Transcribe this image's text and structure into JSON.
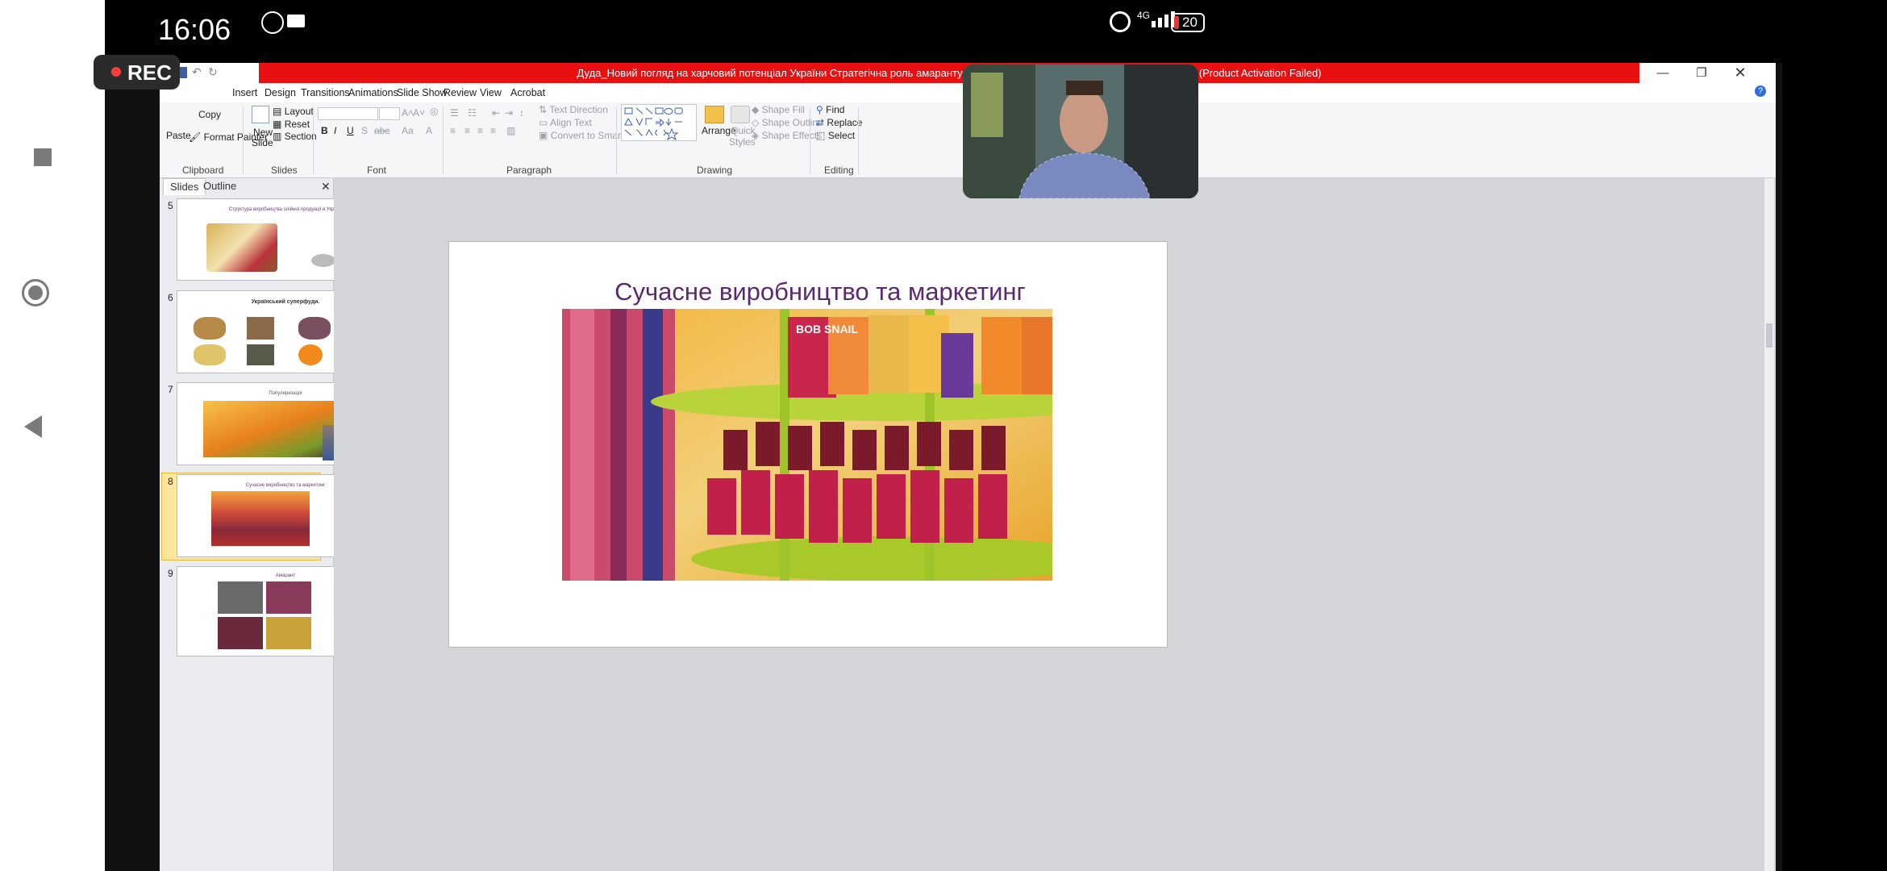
{
  "status_bar": {
    "time": "16:06",
    "network": "4G",
    "battery": "20"
  },
  "rec": {
    "label": "REC"
  },
  "window": {
    "title": "Дуда_Новий погляд на харчовий потенціал України Стратегічна роль амаранту та інших нішевих культур  -  Microsoft PowerPoint (Product Activation Failed)"
  },
  "ribbon_tabs": [
    "Insert",
    "Design",
    "Transitions",
    "Animations",
    "Slide Show",
    "Review",
    "View",
    "Acrobat"
  ],
  "ribbon": {
    "clipboard": {
      "paste": "Paste",
      "copy": "Copy",
      "format_painter": "Format Painter",
      "label": "Clipboard"
    },
    "slides": {
      "new_slide": "New",
      "new_slide2": "Slide",
      "layout": "Layout",
      "reset": "Reset",
      "section": "Section",
      "label": "Slides"
    },
    "font": {
      "label": "Font"
    },
    "paragraph": {
      "text_direction": "Text Direction",
      "align_text": "Align Text",
      "smartart": "Convert to SmartArt",
      "label": "Paragraph"
    },
    "drawing": {
      "arrange": "Arrange",
      "quick_styles": "Quick",
      "quick_styles2": "Styles",
      "shape_fill": "Shape Fill",
      "shape_outline": "Shape Outline",
      "shape_effects": "Shape Effects",
      "label": "Drawing"
    },
    "editing": {
      "find": "Find",
      "replace": "Replace",
      "select": "Select",
      "label": "Editing"
    }
  },
  "panel": {
    "tabs": [
      "Slides",
      "Outline"
    ],
    "thumbnails": [
      {
        "num": "5",
        "title": "Структура виробництва   олійної продукції  в Україні"
      },
      {
        "num": "6",
        "title": "Український суперфуди."
      },
      {
        "num": "7",
        "title": "Популяризація"
      },
      {
        "num": "8",
        "title": "Сучасне  виробництво   та маркетинг"
      },
      {
        "num": "9",
        "title": "Амарант"
      }
    ]
  },
  "slide": {
    "title": "Сучасне виробництво  та маркетинг",
    "image_brand": "BOB SNAIL"
  }
}
